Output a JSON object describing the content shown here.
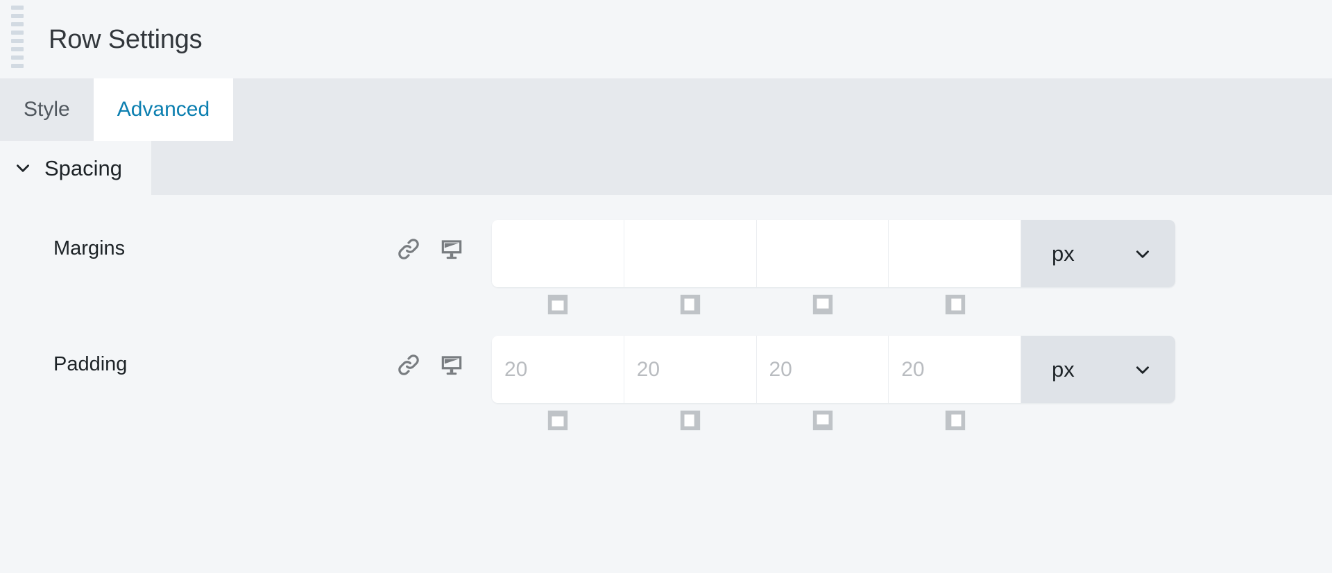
{
  "header": {
    "title": "Row Settings",
    "drag_handle_icon": "drag-handle-icon",
    "drag_handle_bars": 8
  },
  "tabs": [
    {
      "label": "Style",
      "active": false
    },
    {
      "label": "Advanced",
      "active": true
    }
  ],
  "sections": [
    {
      "title": "Spacing",
      "expanded": true,
      "chevron_icon": "chevron-down-icon",
      "fields": [
        {
          "label": "Margins",
          "link_icon": "link-icon",
          "device_icon": "desktop-icon",
          "inputs": [
            {
              "value": "",
              "placeholder": "",
              "side": "top"
            },
            {
              "value": "",
              "placeholder": "",
              "side": "right"
            },
            {
              "value": "",
              "placeholder": "",
              "side": "bottom"
            },
            {
              "value": "",
              "placeholder": "",
              "side": "left"
            }
          ],
          "unit": "px",
          "unit_chevron_icon": "chevron-down-icon",
          "direction_icons": [
            "margin-top-icon",
            "margin-right-icon",
            "margin-bottom-icon",
            "margin-left-icon"
          ]
        },
        {
          "label": "Padding",
          "link_icon": "link-icon",
          "device_icon": "desktop-icon",
          "inputs": [
            {
              "value": "",
              "placeholder": "20",
              "side": "top"
            },
            {
              "value": "",
              "placeholder": "20",
              "side": "right"
            },
            {
              "value": "",
              "placeholder": "20",
              "side": "bottom"
            },
            {
              "value": "",
              "placeholder": "20",
              "side": "left"
            }
          ],
          "unit": "px",
          "unit_chevron_icon": "chevron-down-icon",
          "direction_icons": [
            "padding-top-icon",
            "padding-right-icon",
            "padding-bottom-icon",
            "padding-left-icon"
          ]
        }
      ]
    }
  ],
  "colors": {
    "page_bg": "#f4f6f8",
    "strip_bg": "#e6e9ed",
    "active_tab_text": "#0c7fb0",
    "active_tab_bg": "#ffffff",
    "inactive_tab_text": "#50575e",
    "text": "#1d2327",
    "placeholder": "#b9bcc0",
    "unit_bg": "#dfe3e8",
    "icon_gray": "#787c80",
    "dir_icon_gray": "#bfc3c7",
    "handle_gray": "#d2dae2"
  }
}
